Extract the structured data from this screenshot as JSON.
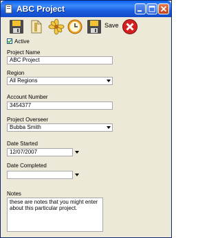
{
  "window": {
    "title": "ABC Project"
  },
  "toolbar": {
    "save_label": "Save",
    "icons": [
      "floppy-disk-icon",
      "document-icon",
      "flower-icon",
      "clock-icon",
      "save-exit-icon",
      "cancel-icon"
    ]
  },
  "form": {
    "active": {
      "label": "Active",
      "checked": true
    },
    "project_name": {
      "label": "Project Name",
      "value": "ABC Project"
    },
    "region": {
      "label": "Region",
      "value": "All Regions"
    },
    "account_number": {
      "label": "Account Number",
      "value": "3454377"
    },
    "project_overseer": {
      "label": "Project Overseer",
      "value": "Bubba Smith"
    },
    "date_started": {
      "label": "Date Started",
      "value": "12/07/2007"
    },
    "date_completed": {
      "label": "Date Completed",
      "value": ""
    },
    "notes": {
      "label": "Notes",
      "value": "these are notes that you might enter about this particular project."
    }
  },
  "colors": {
    "titlebar": "#0a5ef0",
    "window_bg": "#ece9d8",
    "close_red": "#d21f1f"
  }
}
